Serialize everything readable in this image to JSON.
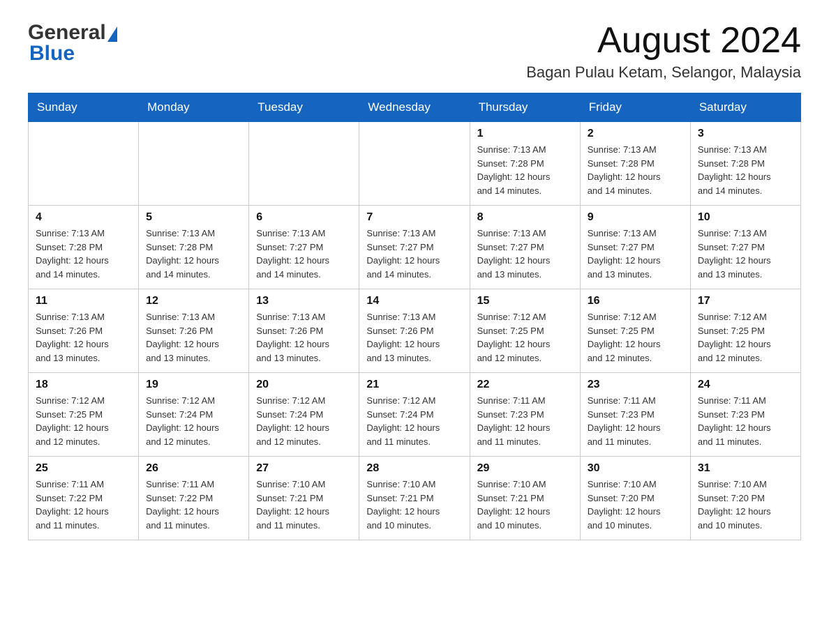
{
  "header": {
    "logo_general": "General",
    "logo_blue": "Blue",
    "month_title": "August 2024",
    "location": "Bagan Pulau Ketam, Selangor, Malaysia"
  },
  "days_of_week": [
    "Sunday",
    "Monday",
    "Tuesday",
    "Wednesday",
    "Thursday",
    "Friday",
    "Saturday"
  ],
  "weeks": [
    {
      "days": [
        {
          "num": "",
          "info": ""
        },
        {
          "num": "",
          "info": ""
        },
        {
          "num": "",
          "info": ""
        },
        {
          "num": "",
          "info": ""
        },
        {
          "num": "1",
          "info": "Sunrise: 7:13 AM\nSunset: 7:28 PM\nDaylight: 12 hours\nand 14 minutes."
        },
        {
          "num": "2",
          "info": "Sunrise: 7:13 AM\nSunset: 7:28 PM\nDaylight: 12 hours\nand 14 minutes."
        },
        {
          "num": "3",
          "info": "Sunrise: 7:13 AM\nSunset: 7:28 PM\nDaylight: 12 hours\nand 14 minutes."
        }
      ]
    },
    {
      "days": [
        {
          "num": "4",
          "info": "Sunrise: 7:13 AM\nSunset: 7:28 PM\nDaylight: 12 hours\nand 14 minutes."
        },
        {
          "num": "5",
          "info": "Sunrise: 7:13 AM\nSunset: 7:28 PM\nDaylight: 12 hours\nand 14 minutes."
        },
        {
          "num": "6",
          "info": "Sunrise: 7:13 AM\nSunset: 7:27 PM\nDaylight: 12 hours\nand 14 minutes."
        },
        {
          "num": "7",
          "info": "Sunrise: 7:13 AM\nSunset: 7:27 PM\nDaylight: 12 hours\nand 14 minutes."
        },
        {
          "num": "8",
          "info": "Sunrise: 7:13 AM\nSunset: 7:27 PM\nDaylight: 12 hours\nand 13 minutes."
        },
        {
          "num": "9",
          "info": "Sunrise: 7:13 AM\nSunset: 7:27 PM\nDaylight: 12 hours\nand 13 minutes."
        },
        {
          "num": "10",
          "info": "Sunrise: 7:13 AM\nSunset: 7:27 PM\nDaylight: 12 hours\nand 13 minutes."
        }
      ]
    },
    {
      "days": [
        {
          "num": "11",
          "info": "Sunrise: 7:13 AM\nSunset: 7:26 PM\nDaylight: 12 hours\nand 13 minutes."
        },
        {
          "num": "12",
          "info": "Sunrise: 7:13 AM\nSunset: 7:26 PM\nDaylight: 12 hours\nand 13 minutes."
        },
        {
          "num": "13",
          "info": "Sunrise: 7:13 AM\nSunset: 7:26 PM\nDaylight: 12 hours\nand 13 minutes."
        },
        {
          "num": "14",
          "info": "Sunrise: 7:13 AM\nSunset: 7:26 PM\nDaylight: 12 hours\nand 13 minutes."
        },
        {
          "num": "15",
          "info": "Sunrise: 7:12 AM\nSunset: 7:25 PM\nDaylight: 12 hours\nand 12 minutes."
        },
        {
          "num": "16",
          "info": "Sunrise: 7:12 AM\nSunset: 7:25 PM\nDaylight: 12 hours\nand 12 minutes."
        },
        {
          "num": "17",
          "info": "Sunrise: 7:12 AM\nSunset: 7:25 PM\nDaylight: 12 hours\nand 12 minutes."
        }
      ]
    },
    {
      "days": [
        {
          "num": "18",
          "info": "Sunrise: 7:12 AM\nSunset: 7:25 PM\nDaylight: 12 hours\nand 12 minutes."
        },
        {
          "num": "19",
          "info": "Sunrise: 7:12 AM\nSunset: 7:24 PM\nDaylight: 12 hours\nand 12 minutes."
        },
        {
          "num": "20",
          "info": "Sunrise: 7:12 AM\nSunset: 7:24 PM\nDaylight: 12 hours\nand 12 minutes."
        },
        {
          "num": "21",
          "info": "Sunrise: 7:12 AM\nSunset: 7:24 PM\nDaylight: 12 hours\nand 11 minutes."
        },
        {
          "num": "22",
          "info": "Sunrise: 7:11 AM\nSunset: 7:23 PM\nDaylight: 12 hours\nand 11 minutes."
        },
        {
          "num": "23",
          "info": "Sunrise: 7:11 AM\nSunset: 7:23 PM\nDaylight: 12 hours\nand 11 minutes."
        },
        {
          "num": "24",
          "info": "Sunrise: 7:11 AM\nSunset: 7:23 PM\nDaylight: 12 hours\nand 11 minutes."
        }
      ]
    },
    {
      "days": [
        {
          "num": "25",
          "info": "Sunrise: 7:11 AM\nSunset: 7:22 PM\nDaylight: 12 hours\nand 11 minutes."
        },
        {
          "num": "26",
          "info": "Sunrise: 7:11 AM\nSunset: 7:22 PM\nDaylight: 12 hours\nand 11 minutes."
        },
        {
          "num": "27",
          "info": "Sunrise: 7:10 AM\nSunset: 7:21 PM\nDaylight: 12 hours\nand 11 minutes."
        },
        {
          "num": "28",
          "info": "Sunrise: 7:10 AM\nSunset: 7:21 PM\nDaylight: 12 hours\nand 10 minutes."
        },
        {
          "num": "29",
          "info": "Sunrise: 7:10 AM\nSunset: 7:21 PM\nDaylight: 12 hours\nand 10 minutes."
        },
        {
          "num": "30",
          "info": "Sunrise: 7:10 AM\nSunset: 7:20 PM\nDaylight: 12 hours\nand 10 minutes."
        },
        {
          "num": "31",
          "info": "Sunrise: 7:10 AM\nSunset: 7:20 PM\nDaylight: 12 hours\nand 10 minutes."
        }
      ]
    }
  ]
}
